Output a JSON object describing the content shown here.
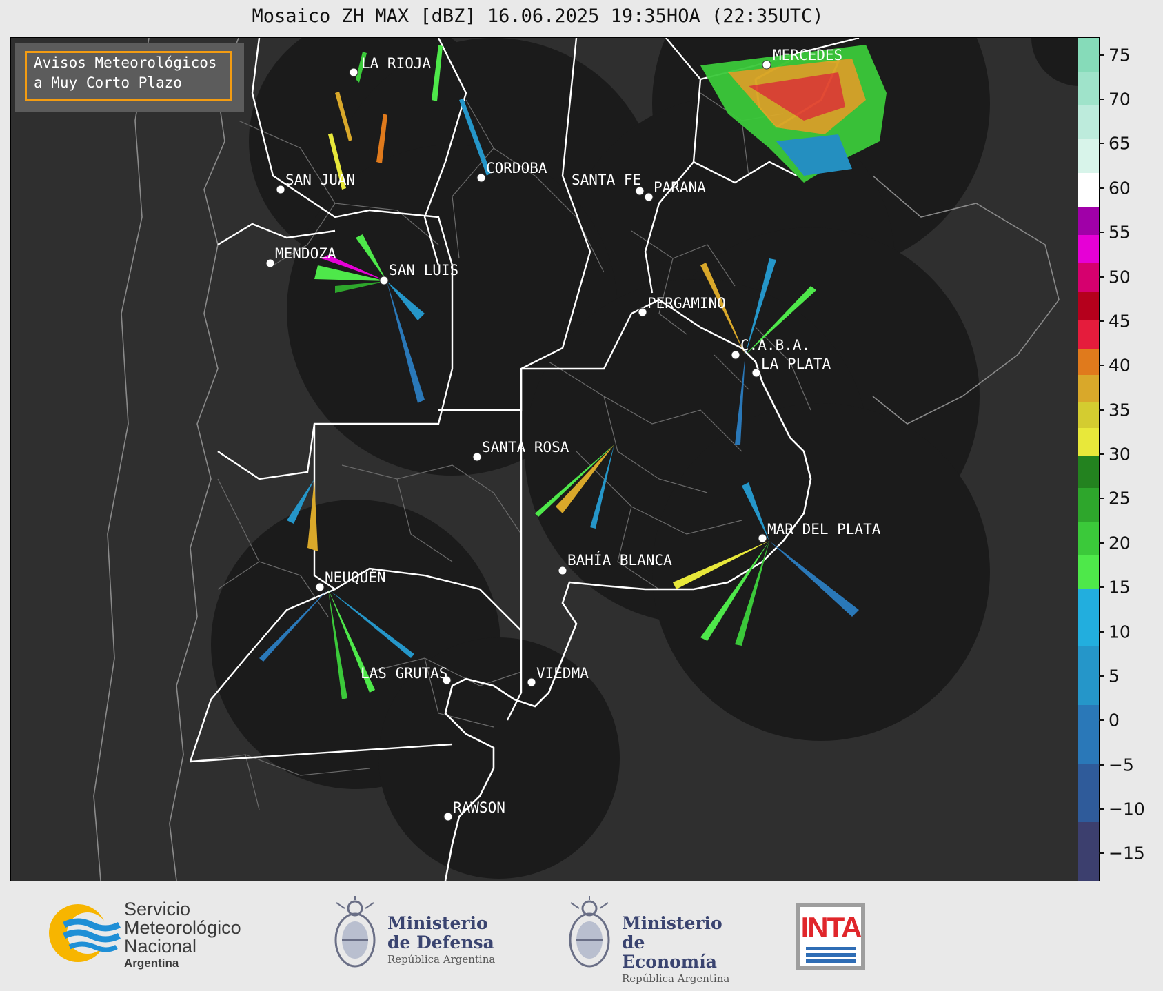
{
  "title": "Mosaico ZH MAX [dBZ] 16.06.2025 19:35HOA (22:35UTC)",
  "avisos": {
    "line1": "Avisos Meteorológicos",
    "line2": "a Muy Corto Plazo",
    "border_color": "#f39c12"
  },
  "cities": [
    {
      "name": "LA RIOJA"
    },
    {
      "name": "SAN JUAN"
    },
    {
      "name": "CORDOBA"
    },
    {
      "name": "SANTA FE"
    },
    {
      "name": "PARANA"
    },
    {
      "name": "MENDOZA"
    },
    {
      "name": "SAN LUIS"
    },
    {
      "name": "PERGAMINO"
    },
    {
      "name": "C.A.B.A."
    },
    {
      "name": "LA PLATA"
    },
    {
      "name": "MERCEDES"
    },
    {
      "name": "SANTA ROSA"
    },
    {
      "name": "MAR DEL PLATA"
    },
    {
      "name": "BAHÍA BLANCA"
    },
    {
      "name": "NEUQUÉN"
    },
    {
      "name": "LAS GRUTAS"
    },
    {
      "name": "VIEDMA"
    },
    {
      "name": "RAWSON"
    }
  ],
  "colorbar": {
    "unit": "dBZ",
    "min": -18,
    "max": 77,
    "ticks": [
      "75",
      "70",
      "65",
      "60",
      "55",
      "50",
      "45",
      "40",
      "35",
      "30",
      "25",
      "20",
      "15",
      "10",
      "5",
      "0",
      "−5",
      "−10",
      "−15"
    ],
    "tick_values": [
      75,
      70,
      65,
      60,
      55,
      50,
      45,
      40,
      35,
      30,
      25,
      20,
      15,
      10,
      5,
      0,
      -5,
      -10,
      -15
    ],
    "bands": [
      {
        "from": -18,
        "to": 15,
        "colors": [
          "#3c3f6e",
          "#2f5b9a",
          "#2a78b8",
          "#2596c9",
          "#22aede"
        ]
      },
      {
        "from": 15,
        "to": 30,
        "colors": [
          "#4ee84a",
          "#3bc93a",
          "#2ea62c",
          "#23821f"
        ]
      },
      {
        "from": 30,
        "to": 42,
        "colors": [
          "#e8e83a",
          "#d4cc30",
          "#d9a82a",
          "#e07a1c"
        ]
      },
      {
        "from": 42,
        "to": 58,
        "colors": [
          "#e51c3c",
          "#b5001c",
          "#d6006e",
          "#e600d6",
          "#a000a8"
        ]
      },
      {
        "from": 58,
        "to": 77,
        "colors": [
          "#ffffff",
          "#d8f4ea",
          "#bdebdc",
          "#9fe3ca",
          "#86dbb9"
        ]
      }
    ]
  },
  "logos": {
    "smn": {
      "line1": "Servicio",
      "line2": "Meteorológico",
      "line3": "Nacional",
      "line4": "Argentina"
    },
    "defensa": {
      "line1": "Ministerio",
      "line2": "de Defensa",
      "line3": "República Argentina"
    },
    "economia": {
      "line1": "Ministerio",
      "line2": "de Economía",
      "line3": "República Argentina"
    },
    "inta": {
      "label": "INTA"
    }
  }
}
